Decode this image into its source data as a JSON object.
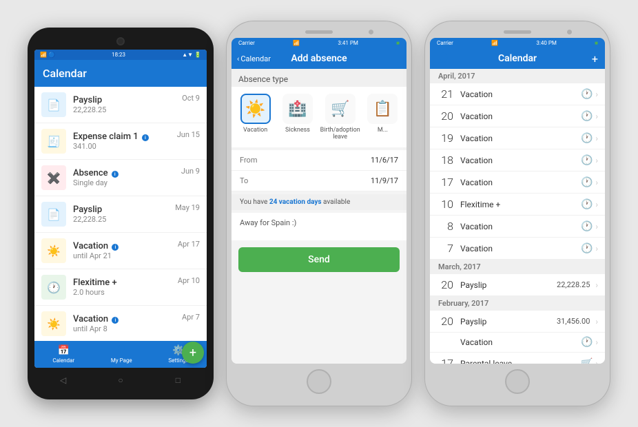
{
  "android": {
    "status_bar": {
      "left_icons": "🔋 📶",
      "time": "18:23",
      "wifi": "▲▼"
    },
    "header": {
      "title": "Calendar"
    },
    "list_items": [
      {
        "icon": "payslip",
        "title": "Payslip",
        "subtitle": "22,228.25",
        "date": "Oct 9",
        "badge": ""
      },
      {
        "icon": "expense",
        "title": "Expense claim 1",
        "subtitle": "341.00",
        "date": "Jun 15",
        "badge": "i"
      },
      {
        "icon": "absence",
        "title": "Absence",
        "subtitle": "Single day",
        "date": "Jun 9",
        "badge": "i"
      },
      {
        "icon": "payslip",
        "title": "Payslip",
        "subtitle": "22,228.25",
        "date": "May 19",
        "badge": ""
      },
      {
        "icon": "vacation",
        "title": "Vacation",
        "subtitle": "until Apr 21",
        "date": "Apr 17",
        "badge": "i"
      },
      {
        "icon": "flexitime",
        "title": "Flexitime +",
        "subtitle": "2.0 hours",
        "date": "Apr 10",
        "badge": ""
      },
      {
        "icon": "vacation",
        "title": "Vacation",
        "subtitle": "until Apr 8",
        "date": "Apr 7",
        "badge": "i"
      }
    ],
    "nav": [
      {
        "icon": "📅",
        "label": "Calendar"
      },
      {
        "icon": "👤",
        "label": "My Page"
      },
      {
        "icon": "⚙️",
        "label": "Settings"
      }
    ],
    "fab_label": "+"
  },
  "add_absence": {
    "status_bar": {
      "carrier": "Carrier",
      "time": "3:41 PM",
      "battery": "●●●"
    },
    "nav_back": "Calendar",
    "nav_title": "Add absence",
    "absence_type_label": "Absence type",
    "types": [
      {
        "icon": "☀️",
        "label": "Vacation",
        "selected": true
      },
      {
        "icon": "🏥",
        "label": "Sickness",
        "selected": false
      },
      {
        "icon": "🛒",
        "label": "Birth/adoption leave",
        "selected": false
      },
      {
        "icon": "📋",
        "label": "More",
        "selected": false
      }
    ],
    "from_label": "From",
    "from_value": "11/6/17",
    "to_label": "To",
    "to_value": "11/9/17",
    "availability_text_1": "You have ",
    "availability_days": "24 vacation days",
    "availability_text_2": " available",
    "notes_placeholder": "Away for Spain :)",
    "send_button": "Send"
  },
  "calendar": {
    "status_bar": {
      "carrier": "Carrier",
      "time": "3:40 PM",
      "battery": "●●●"
    },
    "nav_title": "Calendar",
    "nav_plus": "+",
    "sections": [
      {
        "header": "April, 2017",
        "items": [
          {
            "day": "21",
            "title": "Vacation",
            "value": "",
            "icon": "clock",
            "has_chevron": true
          },
          {
            "day": "20",
            "title": "Vacation",
            "value": "",
            "icon": "clock",
            "has_chevron": true
          },
          {
            "day": "19",
            "title": "Vacation",
            "value": "",
            "icon": "clock",
            "has_chevron": true
          },
          {
            "day": "18",
            "title": "Vacation",
            "value": "",
            "icon": "clock",
            "has_chevron": true
          },
          {
            "day": "17",
            "title": "Vacation",
            "value": "",
            "icon": "clock",
            "has_chevron": true
          },
          {
            "day": "10",
            "title": "Flexitime +",
            "value": "",
            "icon": "clock-green",
            "has_chevron": true
          },
          {
            "day": "8",
            "title": "Vacation",
            "value": "",
            "icon": "clock",
            "has_chevron": true
          },
          {
            "day": "7",
            "title": "Vacation",
            "value": "",
            "icon": "clock",
            "has_chevron": true
          }
        ]
      },
      {
        "header": "March, 2017",
        "items": [
          {
            "day": "20",
            "title": "Payslip",
            "value": "22,228.25",
            "icon": "chevron",
            "has_chevron": true
          }
        ]
      },
      {
        "header": "February, 2017",
        "items": [
          {
            "day": "20",
            "title": "Payslip",
            "value": "31,456.00",
            "icon": "chevron",
            "has_chevron": true
          },
          {
            "day": "",
            "title": "Vacation",
            "value": "",
            "icon": "clock",
            "has_chevron": true
          },
          {
            "day": "17",
            "title": "Parental leave",
            "value": "",
            "icon": "stroller",
            "has_chevron": true
          }
        ]
      }
    ]
  }
}
